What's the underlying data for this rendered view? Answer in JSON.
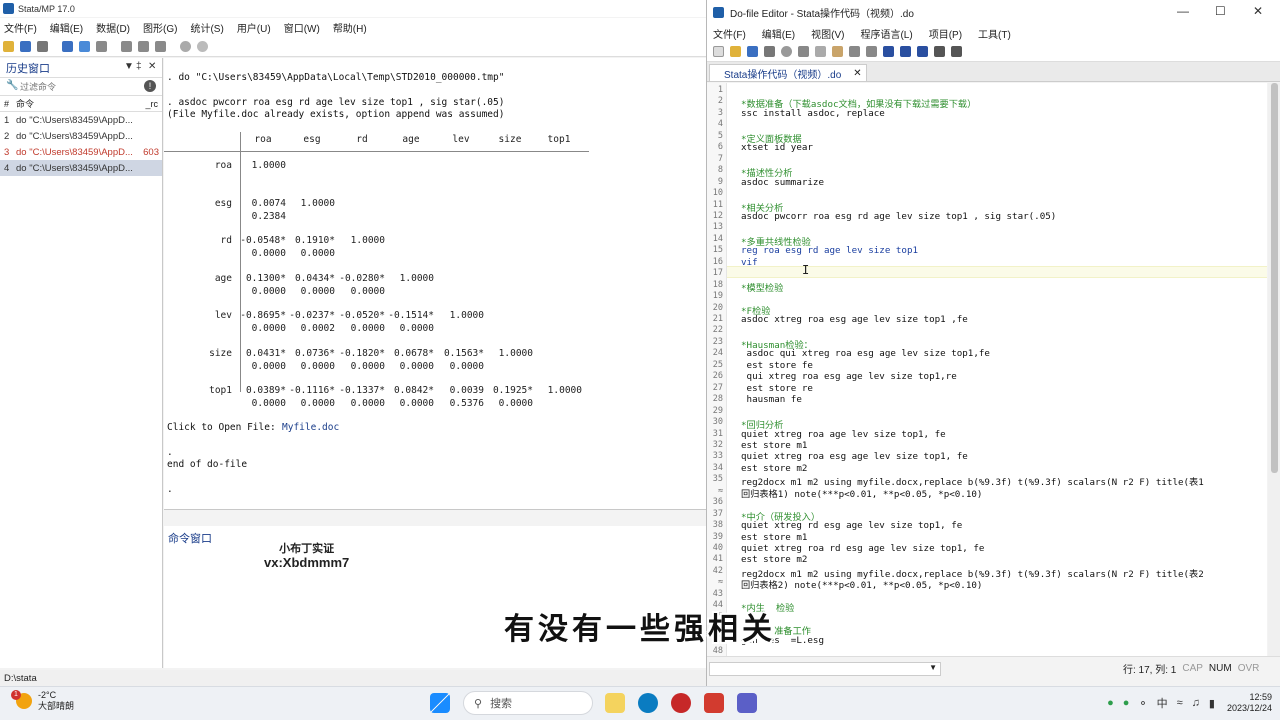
{
  "stata": {
    "title": "Stata/MP 17.0",
    "menus": [
      "文件(F)",
      "编辑(E)",
      "数据(D)",
      "图形(G)",
      "统计(S)",
      "用户(U)",
      "窗口(W)",
      "帮助(H)"
    ],
    "history": {
      "title": "历史窗口",
      "filter_placeholder": "过滤命令",
      "col_hash": "#",
      "col_command": "命令",
      "col_rc": "_rc",
      "rows": [
        {
          "num": "1",
          "cmd": "do \"C:\\Users\\83459\\AppD...",
          "rc": ""
        },
        {
          "num": "2",
          "cmd": "do \"C:\\Users\\83459\\AppD...",
          "rc": ""
        },
        {
          "num": "3",
          "cmd": "do \"C:\\Users\\83459\\AppD...",
          "rc": "603"
        },
        {
          "num": "4",
          "cmd": "do \"C:\\Users\\83459\\AppD...",
          "rc": ""
        }
      ]
    },
    "results": {
      "line1": ". do \"C:\\Users\\83459\\AppData\\Local\\Temp\\STD2010_000000.tmp\"",
      "line2": ". asdoc pwcorr roa esg rd age lev size top1 , sig star(.05)",
      "line3": "(File Myfile.doc already exists, option append was assumed)",
      "corr": {
        "headers": [
          "roa",
          "esg",
          "rd",
          "age",
          "lev",
          "size",
          "top1"
        ],
        "rows": [
          {
            "label": "roa",
            "coef": [
              "1.0000"
            ],
            "sig": []
          },
          {
            "label": "esg",
            "coef": [
              "0.0074",
              "1.0000"
            ],
            "sig": [
              "0.2384"
            ]
          },
          {
            "label": "rd",
            "coef": [
              "-0.0548*",
              "0.1910*",
              "1.0000"
            ],
            "sig": [
              "0.0000",
              "0.0000"
            ]
          },
          {
            "label": "age",
            "coef": [
              "0.1300*",
              "0.0434*",
              "-0.0280*",
              "1.0000"
            ],
            "sig": [
              "0.0000",
              "0.0000",
              "0.0000"
            ]
          },
          {
            "label": "lev",
            "coef": [
              "-0.8695*",
              "-0.0237*",
              "-0.0520*",
              "-0.1514*",
              "1.0000"
            ],
            "sig": [
              "0.0000",
              "0.0002",
              "0.0000",
              "0.0000"
            ]
          },
          {
            "label": "size",
            "coef": [
              "0.0431*",
              "0.0736*",
              "-0.1820*",
              "0.0678*",
              "0.1563*",
              "1.0000"
            ],
            "sig": [
              "0.0000",
              "0.0000",
              "0.0000",
              "0.0000",
              "0.0000"
            ]
          },
          {
            "label": "top1",
            "coef": [
              "0.0389*",
              "-0.1116*",
              "-0.1337*",
              "0.0842*",
              "0.0039",
              "0.1925*",
              "1.0000"
            ],
            "sig": [
              "0.0000",
              "0.0000",
              "0.0000",
              "0.0000",
              "0.5376",
              "0.0000"
            ]
          }
        ]
      },
      "open_file_label": "Click to Open File:",
      "open_file_link": "Myfile.doc",
      "dot1": ".",
      "end_line": "end of do-file",
      "dot2": "."
    },
    "command_label": "命令窗口",
    "watermark_line1": "小布丁实证",
    "watermark_line2": "vx:Xbdmmm7",
    "status_path": "D:\\stata"
  },
  "dofile": {
    "title": "Do-file Editor - Stata操作代码（视频）.do",
    "menus": [
      "文件(F)",
      "编辑(E)",
      "视图(V)",
      "程序语言(L)",
      "项目(P)",
      "工具(T)"
    ],
    "tab_label": "Stata操作代码（视频）.do",
    "lines": [
      {
        "n": "1",
        "t": "",
        "c": ""
      },
      {
        "n": "2",
        "t": "*数据准备（下载asdoc文档，如果没有下载过需要下载）",
        "c": "cm"
      },
      {
        "n": "3",
        "t": "ssc install asdoc, replace",
        "c": ""
      },
      {
        "n": "4",
        "t": "",
        "c": ""
      },
      {
        "n": "5",
        "t": "*定义面板数据",
        "c": "cm"
      },
      {
        "n": "6",
        "t": "xtset id year",
        "c": ""
      },
      {
        "n": "7",
        "t": "",
        "c": ""
      },
      {
        "n": "8",
        "t": "*描述性分析",
        "c": "cm"
      },
      {
        "n": "9",
        "t": "asdoc summarize",
        "c": ""
      },
      {
        "n": "10",
        "t": "",
        "c": ""
      },
      {
        "n": "11",
        "t": "*相关分析",
        "c": "cm"
      },
      {
        "n": "12",
        "t": "asdoc pwcorr roa esg rd age lev size top1 , sig star(.05)",
        "c": ""
      },
      {
        "n": "13",
        "t": "",
        "c": ""
      },
      {
        "n": "14",
        "t": "*多重共线性检验",
        "c": "cm"
      },
      {
        "n": "15",
        "t": "reg roa esg rd age lev size top1",
        "c": "kw"
      },
      {
        "n": "16",
        "t": "vif",
        "c": "kw"
      },
      {
        "n": "17",
        "t": "",
        "c": ""
      },
      {
        "n": "18",
        "t": "*模型检验",
        "c": "cm"
      },
      {
        "n": "19",
        "t": "",
        "c": ""
      },
      {
        "n": "20",
        "t": "*F检验",
        "c": "cm"
      },
      {
        "n": "21",
        "t": "asdoc xtreg roa esg age lev size top1 ,fe",
        "c": ""
      },
      {
        "n": "22",
        "t": "",
        "c": ""
      },
      {
        "n": "23",
        "t": "*Hausman检验：",
        "c": "cm"
      },
      {
        "n": "24",
        "t": " asdoc qui xtreg roa esg age lev size top1,fe",
        "c": ""
      },
      {
        "n": "25",
        "t": " est store fe",
        "c": ""
      },
      {
        "n": "26",
        "t": " qui xtreg roa esg age lev size top1,re",
        "c": ""
      },
      {
        "n": "27",
        "t": " est store re",
        "c": ""
      },
      {
        "n": "28",
        "t": " hausman fe",
        "c": ""
      },
      {
        "n": "29",
        "t": "",
        "c": ""
      },
      {
        "n": "30",
        "t": "*回归分析",
        "c": "cm"
      },
      {
        "n": "31",
        "t": "quiet xtreg roa age lev size top1, fe",
        "c": ""
      },
      {
        "n": "32",
        "t": "est store m1",
        "c": ""
      },
      {
        "n": "33",
        "t": "quiet xtreg roa esg age lev size top1, fe",
        "c": ""
      },
      {
        "n": "34",
        "t": "est store m2",
        "c": ""
      },
      {
        "n": "35",
        "t": "reg2docx m1 m2 using myfile.docx,replace b(%9.3f) t(%9.3f) scalars(N r2 F) title(表1",
        "c": ""
      },
      {
        "n": "≈",
        "t": "回归表格1) note(***p<0.01, **p<0.05, *p<0.10)",
        "c": ""
      },
      {
        "n": "36",
        "t": "",
        "c": ""
      },
      {
        "n": "37",
        "t": "*中介（研发投入）",
        "c": "cm"
      },
      {
        "n": "38",
        "t": "quiet xtreg rd esg age lev size top1, fe",
        "c": ""
      },
      {
        "n": "39",
        "t": "est store m1",
        "c": ""
      },
      {
        "n": "40",
        "t": "quiet xtreg roa rd esg age lev size top1, fe",
        "c": ""
      },
      {
        "n": "41",
        "t": "est store m2",
        "c": ""
      },
      {
        "n": "42",
        "t": "reg2docx m1 m2 using myfile.docx,replace b(%9.3f) t(%9.3f) scalars(N r2 F) title(表2",
        "c": ""
      },
      {
        "n": "≈",
        "t": "回归表格2) note(***p<0.01, **p<0.05, *p<0.10)",
        "c": ""
      },
      {
        "n": "43",
        "t": "",
        "c": ""
      },
      {
        "n": "44",
        "t": "*内生  检验",
        "c": "cm"
      },
      {
        "n": "45",
        "t": "",
        "c": ""
      },
      {
        "n": "46",
        "t": "      准备工作",
        "c": "cm"
      },
      {
        "n": "47",
        "t": "gen les  =L.esg",
        "c": ""
      },
      {
        "n": "48",
        "t": "",
        "c": ""
      }
    ],
    "status": {
      "position": "行: 17, 列: 1",
      "cap": "CAP",
      "num": "NUM",
      "ovr": "OVR"
    }
  },
  "subtitle": "有没有一些强相关",
  "taskbar": {
    "weather_badge": "1",
    "weather_temp": "-2°C",
    "weather_desc": "大部晴朗",
    "search_label": "搜索",
    "tray_ime": "中",
    "time": "12:59",
    "date": "2023/12/24"
  }
}
